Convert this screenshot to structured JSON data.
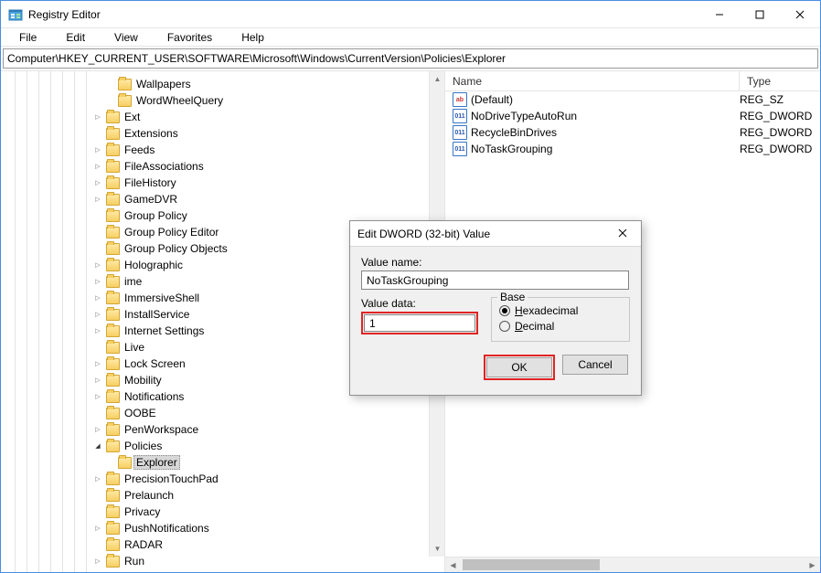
{
  "window": {
    "title": "Registry Editor"
  },
  "menu": {
    "file": "File",
    "edit": "Edit",
    "view": "View",
    "favorites": "Favorites",
    "help": "Help"
  },
  "address": "Computer\\HKEY_CURRENT_USER\\SOFTWARE\\Microsoft\\Windows\\CurrentVersion\\Policies\\Explorer",
  "tree": [
    {
      "depth": 8,
      "exp": "",
      "label": "Wallpapers"
    },
    {
      "depth": 8,
      "exp": "",
      "label": "WordWheelQuery"
    },
    {
      "depth": 7,
      "exp": "right",
      "label": "Ext"
    },
    {
      "depth": 7,
      "exp": "",
      "label": "Extensions"
    },
    {
      "depth": 7,
      "exp": "right",
      "label": "Feeds"
    },
    {
      "depth": 7,
      "exp": "right",
      "label": "FileAssociations"
    },
    {
      "depth": 7,
      "exp": "right",
      "label": "FileHistory"
    },
    {
      "depth": 7,
      "exp": "right",
      "label": "GameDVR"
    },
    {
      "depth": 7,
      "exp": "",
      "label": "Group Policy"
    },
    {
      "depth": 7,
      "exp": "",
      "label": "Group Policy Editor"
    },
    {
      "depth": 7,
      "exp": "",
      "label": "Group Policy Objects"
    },
    {
      "depth": 7,
      "exp": "right",
      "label": "Holographic"
    },
    {
      "depth": 7,
      "exp": "right",
      "label": "ime"
    },
    {
      "depth": 7,
      "exp": "right",
      "label": "ImmersiveShell"
    },
    {
      "depth": 7,
      "exp": "right",
      "label": "InstallService"
    },
    {
      "depth": 7,
      "exp": "right",
      "label": "Internet Settings"
    },
    {
      "depth": 7,
      "exp": "",
      "label": "Live"
    },
    {
      "depth": 7,
      "exp": "right",
      "label": "Lock Screen"
    },
    {
      "depth": 7,
      "exp": "right",
      "label": "Mobility"
    },
    {
      "depth": 7,
      "exp": "right",
      "label": "Notifications"
    },
    {
      "depth": 7,
      "exp": "",
      "label": "OOBE"
    },
    {
      "depth": 7,
      "exp": "right",
      "label": "PenWorkspace"
    },
    {
      "depth": 7,
      "exp": "down",
      "label": "Policies"
    },
    {
      "depth": 8,
      "exp": "",
      "label": "Explorer",
      "selected": true
    },
    {
      "depth": 7,
      "exp": "right",
      "label": "PrecisionTouchPad"
    },
    {
      "depth": 7,
      "exp": "",
      "label": "Prelaunch"
    },
    {
      "depth": 7,
      "exp": "",
      "label": "Privacy"
    },
    {
      "depth": 7,
      "exp": "right",
      "label": "PushNotifications"
    },
    {
      "depth": 7,
      "exp": "",
      "label": "RADAR"
    },
    {
      "depth": 7,
      "exp": "right",
      "label": "Run"
    }
  ],
  "columns": {
    "name": "Name",
    "type": "Type"
  },
  "values": [
    {
      "icon": "str",
      "name": "(Default)",
      "type": "REG_SZ"
    },
    {
      "icon": "dword",
      "name": "NoDriveTypeAutoRun",
      "type": "REG_DWORD"
    },
    {
      "icon": "dword",
      "name": "RecycleBinDrives",
      "type": "REG_DWORD"
    },
    {
      "icon": "dword",
      "name": "NoTaskGrouping",
      "type": "REG_DWORD"
    }
  ],
  "dialog": {
    "title": "Edit DWORD (32-bit) Value",
    "value_name_label": "Value name:",
    "value_name": "NoTaskGrouping",
    "value_data_label": "Value data:",
    "value_data": "1",
    "base_label": "Base",
    "hex": "Hexadecimal",
    "dec": "Decimal",
    "ok": "OK",
    "cancel": "Cancel"
  }
}
